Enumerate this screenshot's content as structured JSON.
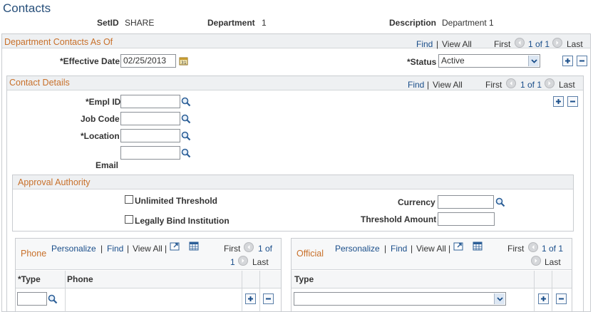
{
  "page": {
    "title": "Contacts"
  },
  "header": {
    "setid_label": "SetID",
    "setid_value": "SHARE",
    "department_label": "Department",
    "department_value": "1",
    "description_label": "Description",
    "description_value": "Department 1"
  },
  "dept_contacts": {
    "title": "Department Contacts As Of",
    "nav": {
      "find": "Find",
      "sep": "|",
      "view_all": "View All",
      "first": "First",
      "range": "1 of 1",
      "last": "Last"
    },
    "effective_date_label": "*Effective Date",
    "effective_date_value": "02/25/2013",
    "status_label": "*Status",
    "status_value": "Active"
  },
  "contact_details": {
    "title": "Contact Details",
    "nav": {
      "find": "Find",
      "sep": "|",
      "view_all": "View All",
      "first": "First",
      "range": "1 of 1",
      "last": "Last"
    },
    "empl_id_label": "*Empl ID",
    "empl_id_value": "",
    "job_code_label": "Job Code",
    "job_code_value": "",
    "location_label": "*Location",
    "location_value": "",
    "email_label": "Email",
    "email_value": ""
  },
  "approval": {
    "title": "Approval Authority",
    "unlimited_label": "Unlimited Threshold",
    "legally_label": "Legally Bind Institution",
    "currency_label": "Currency",
    "currency_value": "",
    "threshold_label": "Threshold Amount",
    "threshold_value": ""
  },
  "phone_grid": {
    "title": "Phone",
    "personalize": "Personalize",
    "sep": "|",
    "find": "Find",
    "view_all": "View All",
    "first": "First",
    "range_a": "1 of",
    "range_b": "1",
    "last": "Last",
    "col_type": "*Type",
    "col_phone": "Phone"
  },
  "official_grid": {
    "title": "Official",
    "personalize": "Personalize",
    "sep": "|",
    "find": "Find",
    "view_all": "View All",
    "first": "First",
    "range": "1 of 1",
    "last": "Last",
    "col_type": "Type"
  },
  "icons": {
    "lookup": "magnifier-icon",
    "calendar": "calendar-icon",
    "add": "plus-icon",
    "delete": "minus-icon",
    "prev": "left-arrow-icon",
    "next": "right-arrow-icon",
    "zoom": "zoom-icon",
    "download": "download-icon"
  }
}
